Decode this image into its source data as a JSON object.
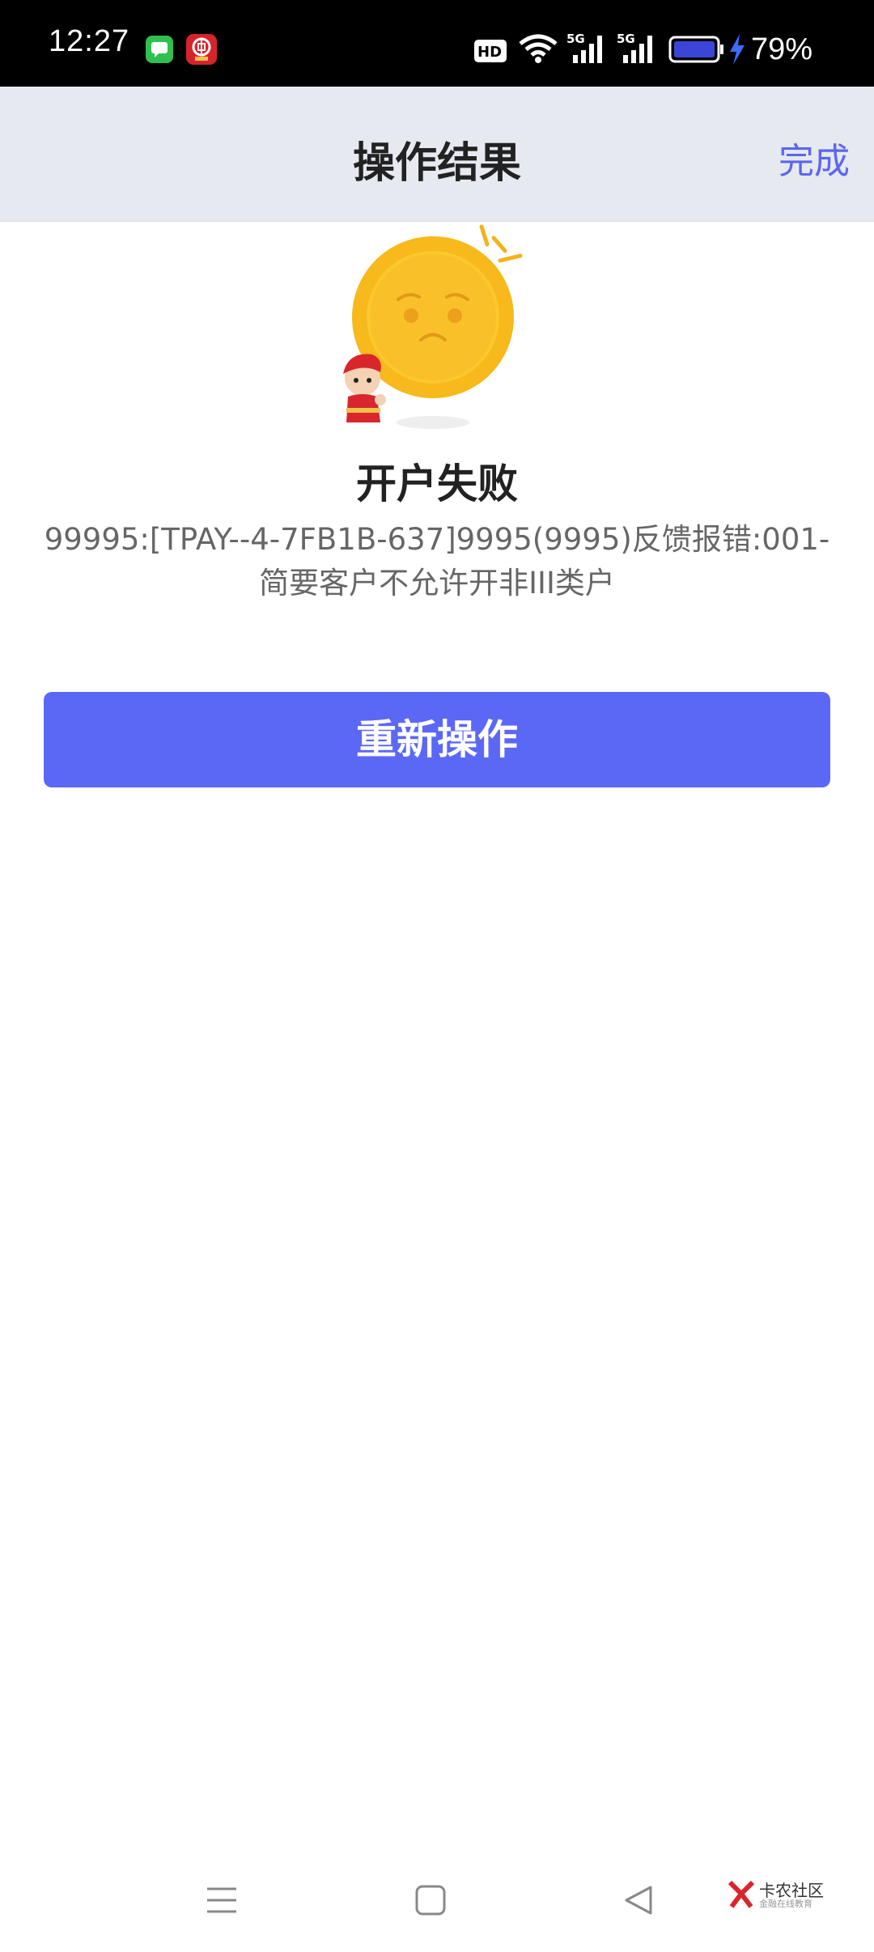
{
  "status_bar": {
    "time": "12:27",
    "battery_percent": "79%",
    "network_badges": [
      "HD",
      "5G",
      "5G"
    ],
    "icons": [
      "messages-app-icon",
      "bank-app-icon",
      "hd-icon",
      "wifi-icon",
      "signal-icon",
      "signal-icon",
      "battery-icon",
      "charging-bolt-icon"
    ]
  },
  "header": {
    "title": "操作结果",
    "done_label": "完成"
  },
  "result": {
    "illustration": "sad-coin-with-mascot",
    "title": "开户失败",
    "message": "99995:[TPAY--4-7FB1B-637]9995(9995)反馈报错:001-简要客户不允许开非III类户"
  },
  "actions": {
    "retry_label": "重新操作"
  },
  "navbar": {
    "buttons": [
      "menu-icon",
      "home-icon",
      "back-icon"
    ]
  },
  "watermark": {
    "title": "卡农社区",
    "subtitle": "金融在线教育"
  },
  "colors": {
    "accent": "#5b68f6",
    "link": "#5b67ef",
    "header_bg": "#e6e9ef",
    "coin": "#f7b91b"
  }
}
